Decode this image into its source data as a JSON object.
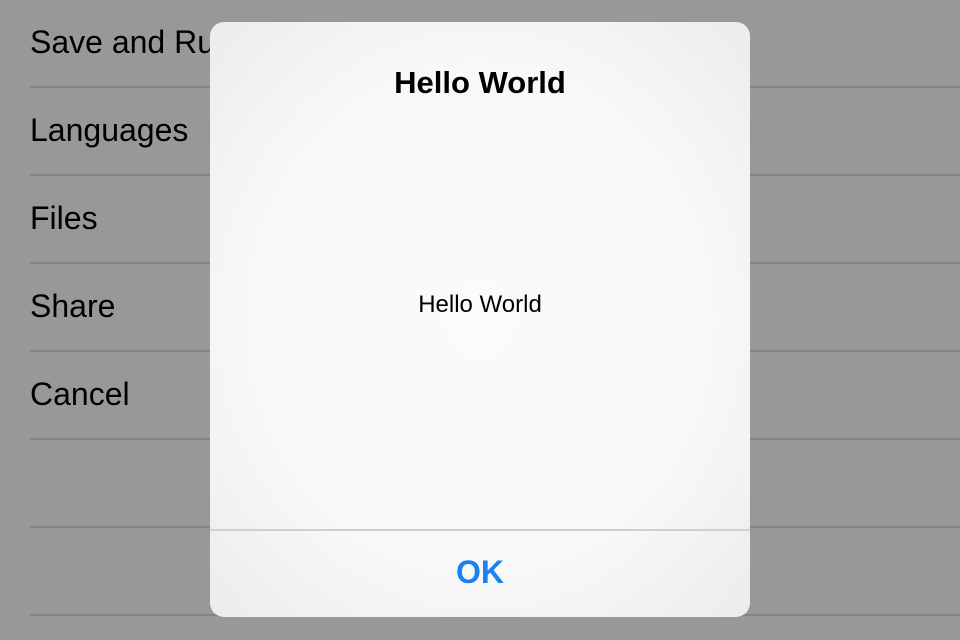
{
  "menu": {
    "items": [
      {
        "label": "Save and Run"
      },
      {
        "label": "Languages"
      },
      {
        "label": "Files"
      },
      {
        "label": "Share"
      },
      {
        "label": "Cancel"
      },
      {
        "label": ""
      },
      {
        "label": ""
      }
    ]
  },
  "alert": {
    "title": "Hello World",
    "message": "Hello World",
    "ok_label": "OK"
  },
  "colors": {
    "accent": "#1a82f0",
    "overlay": "#989898",
    "separator": "#838383"
  }
}
